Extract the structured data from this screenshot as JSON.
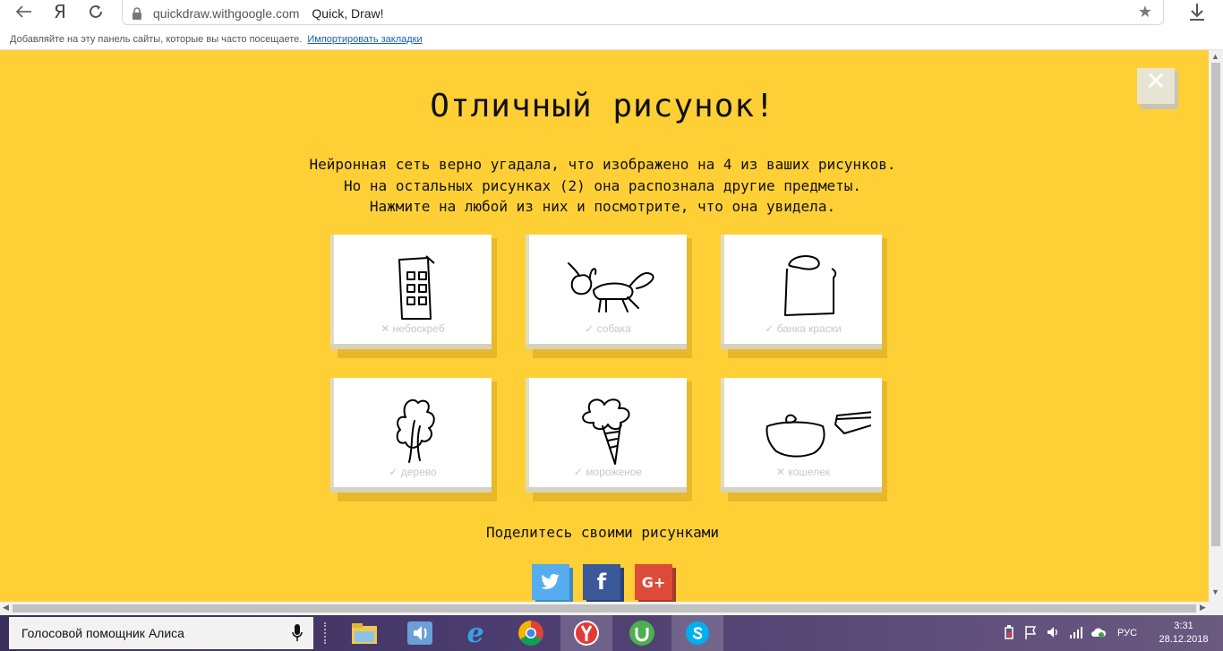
{
  "browser": {
    "url": "quickdraw.withgoogle.com",
    "tab_title": "Quick, Draw!",
    "back_icon": "back-arrow-icon",
    "yandex_icon": "Я",
    "star_icon": "★"
  },
  "bookmarks_bar": {
    "text": "Добавляйте на эту панель сайты, которые вы часто посещаете.",
    "link": "Импортировать закладки"
  },
  "result": {
    "title": "Отличный рисунок!",
    "desc_line1": "Нейронная сеть верно угадала, что изображено на 4 из ваших рисунков.",
    "desc_line2": "Но на остальных рисунках (2) она распознала другие предметы.",
    "desc_line3": "Нажмите на любой из них и посмотрите, что она увидела.",
    "close": "✕",
    "drawings": [
      {
        "label": "✕ небоскреб",
        "correct": false
      },
      {
        "label": "✓ собака",
        "correct": true
      },
      {
        "label": "✓ банка краски",
        "correct": true
      },
      {
        "label": "✓ дерево",
        "correct": true
      },
      {
        "label": "✓ мороженое",
        "correct": true
      },
      {
        "label": "✕ кошелек",
        "correct": false
      }
    ],
    "share_label": "Поделитесь своими рисунками",
    "share": {
      "twitter": "twitter",
      "facebook": "f",
      "gplus": "G+"
    },
    "colors": {
      "background": "#ffd036",
      "card": "#ffffff",
      "twitter": "#55acee",
      "facebook": "#3b5998",
      "gplus": "#dd4b39"
    }
  },
  "taskbar": {
    "assistant": "Голосовой помощник Алиса",
    "language": "РУС",
    "time": "3:31",
    "date": "28.12.2018"
  }
}
